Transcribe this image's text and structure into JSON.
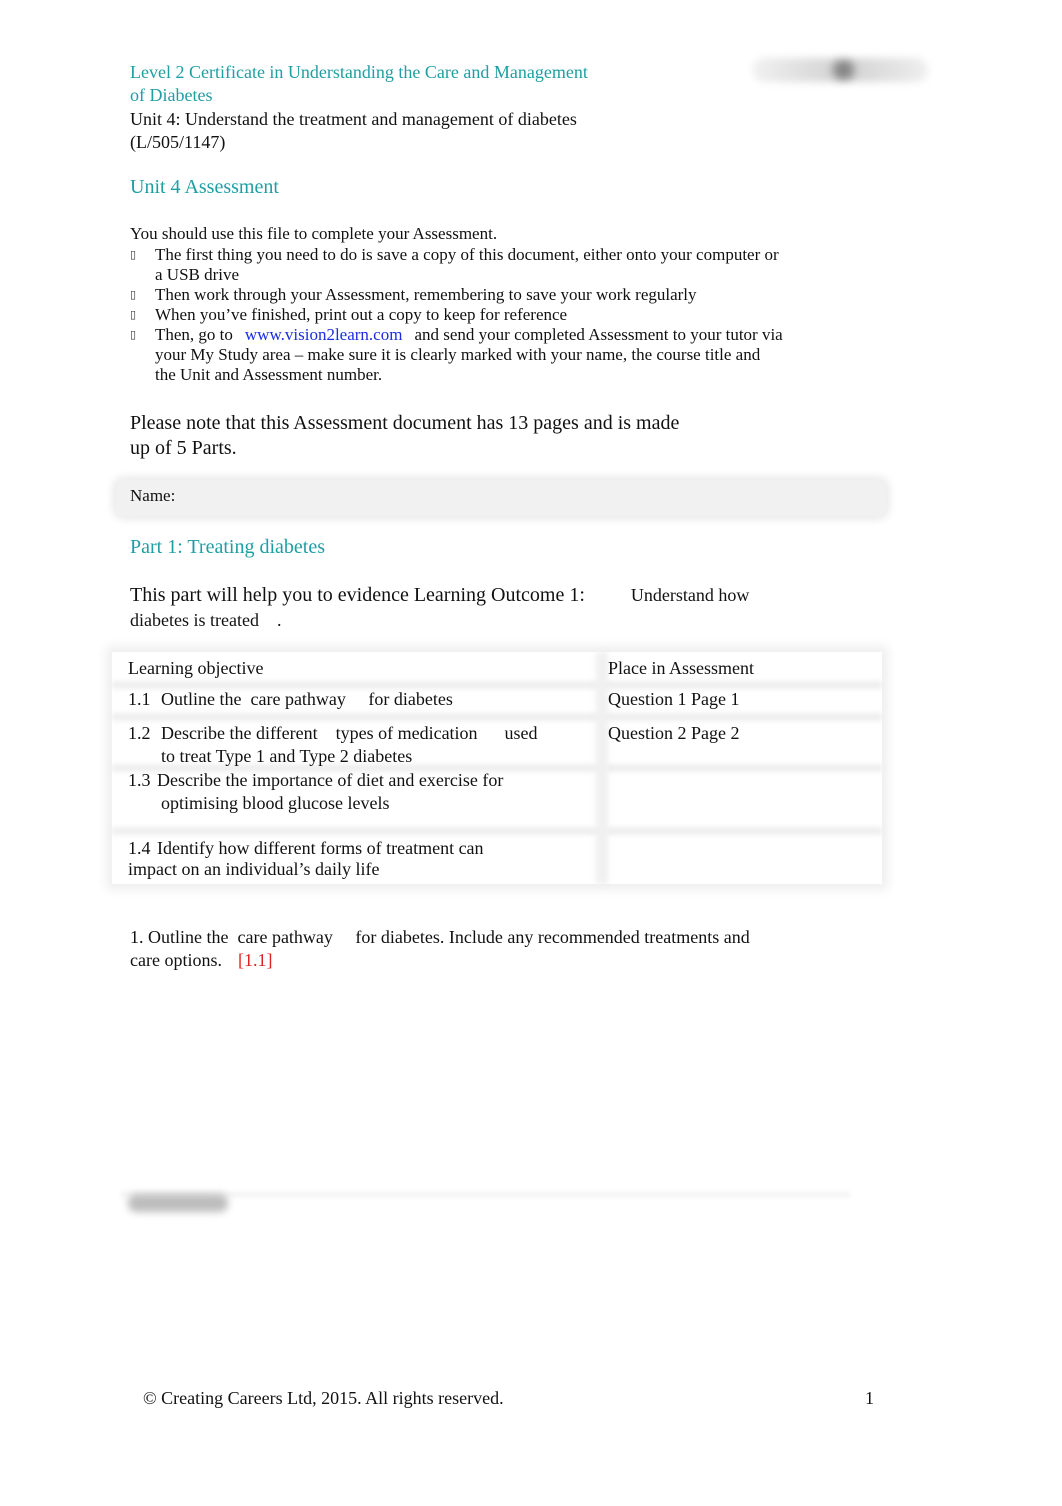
{
  "header": {
    "course_title_line1": "Level 2 Certificate in Understanding the Care and Management",
    "course_title_line2": "of Diabetes",
    "unit_line1": "Unit 4: Understand the treatment and management of diabetes",
    "unit_line2": "(L/505/1147)",
    "logo_icon": "blurred-logo"
  },
  "assessment_heading": "Unit 4 Assessment",
  "instructions": {
    "intro": "You should use this file to complete your Assessment.",
    "bullet_icon": "missing-glyph-bullet",
    "bullets": [
      {
        "line1": "The first thing you need to do is save a copy of this document, either onto your computer or",
        "line2": "a USB drive"
      },
      {
        "line1": "Then work through your Assessment, remembering to save your work regularly"
      },
      {
        "line1": "When you’ve finished, print out a copy to keep for reference"
      },
      {
        "prefix": "Then, go to",
        "link": "www.vision2learn.com",
        "suffix": "and send your completed Assessment to your tutor via",
        "line2": "your My Study area – make sure it is clearly marked with your name, the course title and",
        "line3": "the Unit and Assessment number."
      }
    ]
  },
  "note": {
    "line1": "Please note that this Assessment document has 13 pages and is made",
    "line2": "up of 5 Parts."
  },
  "name_field": {
    "label": "Name:",
    "value": ""
  },
  "part1": {
    "heading": "Part 1: Treating diabetes",
    "intro_line1_a": "This part will help you to evidence Learning Outcome 1:",
    "intro_line1_b": "Understand how",
    "intro_line2_a": "diabetes is treated",
    "intro_line2_b": "."
  },
  "objectives_table": {
    "headers": [
      "Learning objective",
      "Place in Assessment"
    ],
    "rows": [
      {
        "num": "1.1",
        "line1": "Outline the  care pathway     for diabetes",
        "line2": "",
        "place": "Question 1 Page 1"
      },
      {
        "num": "1.2",
        "line1": "Describe the different    types of medication      used",
        "line2": "to treat Type 1 and Type 2 diabetes",
        "place": "Question 2 Page 2"
      },
      {
        "num": "1.3",
        "line1": "Describe the importance of diet and exercise for",
        "line2": "optimising blood glucose levels",
        "place": ""
      },
      {
        "num": "1.4",
        "line1": "Identify how different forms of treatment can",
        "line2": "impact on an individual’s daily life",
        "place": ""
      }
    ]
  },
  "question1": {
    "line1": "1. Outline the  care pathway     for diabetes. Include any recommended treatments and",
    "line2": "care options.",
    "ref": "[1.1]",
    "answer": ""
  },
  "footer": {
    "copyright": "© Creating Careers Ltd, 2015. All rights reserved.",
    "page_number": "1"
  },
  "colors": {
    "heading_teal": "#1f9ea3",
    "link_blue": "#1a2ee0",
    "reference_red": "#e02020"
  }
}
